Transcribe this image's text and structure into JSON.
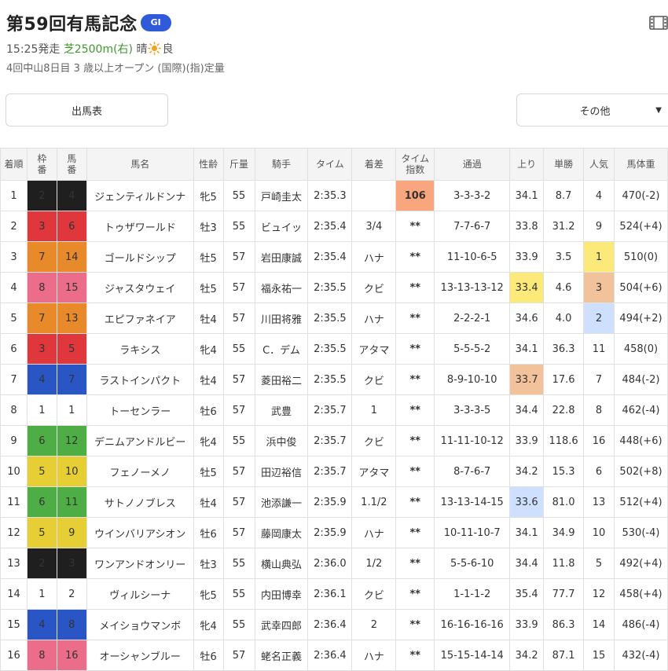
{
  "header": {
    "title": "第59回有馬記念",
    "grade": "GI",
    "start_time": "15:25発走",
    "course": "芝2500m(右)",
    "weather_label": "晴",
    "condition": "良",
    "sub_info": "4回中山8日目 3 歳以上オープン (国際)(指)定量"
  },
  "buttons": {
    "shutuba": "出馬表",
    "other": "その他"
  },
  "icons": {
    "weather": "sun-icon",
    "movie": "film-icon",
    "caret": "caret-down-icon"
  },
  "table": {
    "headers": {
      "rank": "着順",
      "waku": "枠番",
      "umaban": "馬番",
      "horse": "馬名",
      "sexage": "性齢",
      "weight": "斤量",
      "jockey": "騎手",
      "time": "タイム",
      "margin": "着差",
      "time_index": "タイム指数",
      "passing": "通過",
      "last3f": "上り",
      "odds": "単勝",
      "popularity": "人気",
      "body_weight": "馬体重"
    },
    "rows": [
      {
        "rank": "1",
        "waku": "2",
        "umaban": "4",
        "horse": "ジェンティルドンナ",
        "sexage": "牝5",
        "weight": "55",
        "jockey": "戸崎圭太",
        "time": "2:35.3",
        "margin": "",
        "time_index": "106",
        "passing": "3-3-3-2",
        "last3f": "34.1",
        "odds": "8.7",
        "popularity": "4",
        "body_weight": "470(-2)"
      },
      {
        "rank": "2",
        "waku": "3",
        "umaban": "6",
        "horse": "トゥザワールド",
        "sexage": "牡3",
        "weight": "55",
        "jockey": "ビュイッ",
        "time": "2:35.4",
        "margin": "3/4",
        "time_index": "**",
        "passing": "7-7-6-7",
        "last3f": "33.8",
        "odds": "31.2",
        "popularity": "9",
        "body_weight": "524(+4)"
      },
      {
        "rank": "3",
        "waku": "7",
        "umaban": "14",
        "horse": "ゴールドシップ",
        "sexage": "牡5",
        "weight": "57",
        "jockey": "岩田康誠",
        "time": "2:35.4",
        "margin": "ハナ",
        "time_index": "**",
        "passing": "11-10-6-5",
        "last3f": "33.9",
        "odds": "3.5",
        "popularity": "1",
        "body_weight": "510(0)"
      },
      {
        "rank": "4",
        "waku": "8",
        "umaban": "15",
        "horse": "ジャスタウェイ",
        "sexage": "牡5",
        "weight": "57",
        "jockey": "福永祐一",
        "time": "2:35.5",
        "margin": "クビ",
        "time_index": "**",
        "passing": "13-13-13-12",
        "last3f": "33.4",
        "odds": "4.6",
        "popularity": "3",
        "body_weight": "504(+6)"
      },
      {
        "rank": "5",
        "waku": "7",
        "umaban": "13",
        "horse": "エピファネイア",
        "sexage": "牡4",
        "weight": "57",
        "jockey": "川田将雅",
        "time": "2:35.5",
        "margin": "ハナ",
        "time_index": "**",
        "passing": "2-2-2-1",
        "last3f": "34.6",
        "odds": "4.0",
        "popularity": "2",
        "body_weight": "494(+2)"
      },
      {
        "rank": "6",
        "waku": "3",
        "umaban": "5",
        "horse": "ラキシス",
        "sexage": "牝4",
        "weight": "55",
        "jockey": "C．デム",
        "time": "2:35.5",
        "margin": "アタマ",
        "time_index": "**",
        "passing": "5-5-5-2",
        "last3f": "34.1",
        "odds": "36.3",
        "popularity": "11",
        "body_weight": "458(0)"
      },
      {
        "rank": "7",
        "waku": "4",
        "umaban": "7",
        "horse": "ラストインパクト",
        "sexage": "牡4",
        "weight": "57",
        "jockey": "菱田裕二",
        "time": "2:35.5",
        "margin": "クビ",
        "time_index": "**",
        "passing": "8-9-10-10",
        "last3f": "33.7",
        "odds": "17.6",
        "popularity": "7",
        "body_weight": "484(-2)"
      },
      {
        "rank": "8",
        "waku": "1",
        "umaban": "1",
        "horse": "トーセンラー",
        "sexage": "牡6",
        "weight": "57",
        "jockey": "武豊",
        "time": "2:35.7",
        "margin": "1",
        "time_index": "**",
        "passing": "3-3-3-5",
        "last3f": "34.4",
        "odds": "22.8",
        "popularity": "8",
        "body_weight": "462(-4)"
      },
      {
        "rank": "9",
        "waku": "6",
        "umaban": "12",
        "horse": "デニムアンドルビー",
        "sexage": "牝4",
        "weight": "55",
        "jockey": "浜中俊",
        "time": "2:35.7",
        "margin": "クビ",
        "time_index": "**",
        "passing": "11-11-10-12",
        "last3f": "33.9",
        "odds": "118.6",
        "popularity": "16",
        "body_weight": "448(+6)"
      },
      {
        "rank": "10",
        "waku": "5",
        "umaban": "10",
        "horse": "フェノーメノ",
        "sexage": "牡5",
        "weight": "57",
        "jockey": "田辺裕信",
        "time": "2:35.7",
        "margin": "アタマ",
        "time_index": "**",
        "passing": "8-7-6-7",
        "last3f": "34.2",
        "odds": "15.3",
        "popularity": "6",
        "body_weight": "502(+8)"
      },
      {
        "rank": "11",
        "waku": "6",
        "umaban": "11",
        "horse": "サトノノブレス",
        "sexage": "牡4",
        "weight": "57",
        "jockey": "池添謙一",
        "time": "2:35.9",
        "margin": "1.1/2",
        "time_index": "**",
        "passing": "13-13-14-15",
        "last3f": "33.6",
        "odds": "81.0",
        "popularity": "13",
        "body_weight": "512(+4)"
      },
      {
        "rank": "12",
        "waku": "5",
        "umaban": "9",
        "horse": "ウインバリアシオン",
        "sexage": "牡6",
        "weight": "57",
        "jockey": "藤岡康太",
        "time": "2:35.9",
        "margin": "ハナ",
        "time_index": "**",
        "passing": "10-11-10-7",
        "last3f": "34.1",
        "odds": "34.9",
        "popularity": "10",
        "body_weight": "530(-4)"
      },
      {
        "rank": "13",
        "waku": "2",
        "umaban": "3",
        "horse": "ワンアンドオンリー",
        "sexage": "牡3",
        "weight": "55",
        "jockey": "横山典弘",
        "time": "2:36.0",
        "margin": "1/2",
        "time_index": "**",
        "passing": "5-5-6-10",
        "last3f": "34.4",
        "odds": "11.8",
        "popularity": "5",
        "body_weight": "492(+4)"
      },
      {
        "rank": "14",
        "waku": "1",
        "umaban": "2",
        "horse": "ヴィルシーナ",
        "sexage": "牝5",
        "weight": "55",
        "jockey": "内田博幸",
        "time": "2:36.1",
        "margin": "クビ",
        "time_index": "**",
        "passing": "1-1-1-2",
        "last3f": "35.4",
        "odds": "77.7",
        "popularity": "12",
        "body_weight": "458(+4)"
      },
      {
        "rank": "15",
        "waku": "4",
        "umaban": "8",
        "horse": "メイショウマンボ",
        "sexage": "牝4",
        "weight": "55",
        "jockey": "武幸四郎",
        "time": "2:36.4",
        "margin": "2",
        "time_index": "**",
        "passing": "16-16-16-16",
        "last3f": "33.9",
        "odds": "86.3",
        "popularity": "14",
        "body_weight": "486(-4)"
      },
      {
        "rank": "16",
        "waku": "8",
        "umaban": "16",
        "horse": "オーシャンブルー",
        "sexage": "牡6",
        "weight": "57",
        "jockey": "蛯名正義",
        "time": "2:36.4",
        "margin": "ハナ",
        "time_index": "**",
        "passing": "15-15-14-14",
        "last3f": "34.2",
        "odds": "87.1",
        "popularity": "15",
        "body_weight": "432(-4)"
      }
    ]
  },
  "colors": {
    "waku": {
      "1": "#ffffff",
      "2": "#1f1f1f",
      "3": "#e0373c",
      "4": "#2a55c4",
      "5": "#e5cf35",
      "6": "#4eae45",
      "7": "#e8892a",
      "8": "#ec6d8a"
    },
    "grade_badge": "#2f5bd8",
    "course_text": "#3b9a2b",
    "link_text": "#1b3c9e",
    "highlight_first": "#fbe97a",
    "highlight_second": "#f2c29a",
    "highlight_third": "#cfe0ff",
    "highlight_time_index": "#f9a67e"
  }
}
